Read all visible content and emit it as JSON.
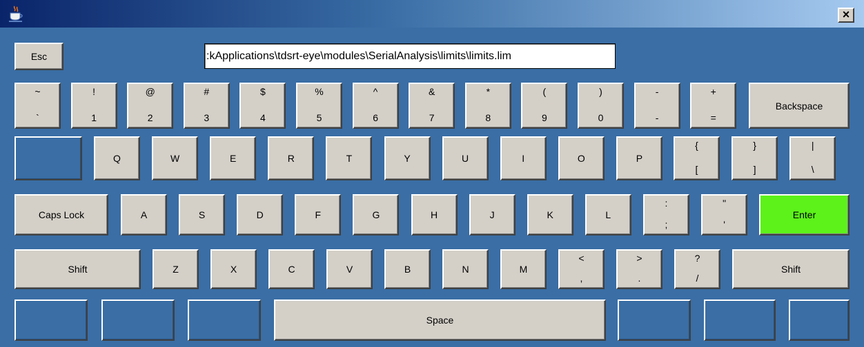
{
  "window": {
    "close_label": "×"
  },
  "path_field": {
    "value": ":kApplications\\tdsrt-eye\\modules\\SerialAnalysis\\limits\\limits.lim"
  },
  "keys": {
    "esc": "Esc",
    "backspace": "Backspace",
    "caps": "Caps Lock",
    "enter": "Enter",
    "shift": "Shift",
    "space": "Space",
    "enter_color": "#5cf21a"
  },
  "number_row": [
    {
      "top": "~",
      "bottom": "`"
    },
    {
      "top": "!",
      "bottom": "1"
    },
    {
      "top": "@",
      "bottom": "2"
    },
    {
      "top": "#",
      "bottom": "3"
    },
    {
      "top": "$",
      "bottom": "4"
    },
    {
      "top": "%",
      "bottom": "5"
    },
    {
      "top": "^",
      "bottom": "6"
    },
    {
      "top": "&",
      "bottom": "7"
    },
    {
      "top": "*",
      "bottom": "8"
    },
    {
      "top": "(",
      "bottom": "9"
    },
    {
      "top": ")",
      "bottom": "0"
    },
    {
      "top": "-",
      "bottom": "-"
    },
    {
      "top": "+",
      "bottom": "="
    }
  ],
  "qwerty_row": [
    "Q",
    "W",
    "E",
    "R",
    "T",
    "Y",
    "U",
    "I",
    "O",
    "P"
  ],
  "qwerty_symbols": [
    {
      "top": "{",
      "bottom": "["
    },
    {
      "top": "}",
      "bottom": "]"
    },
    {
      "top": "|",
      "bottom": "\\"
    }
  ],
  "home_row": [
    "A",
    "S",
    "D",
    "F",
    "G",
    "H",
    "J",
    "K",
    "L"
  ],
  "home_symbols": [
    {
      "top": ":",
      "bottom": ";"
    },
    {
      "top": "\"",
      "bottom": "'"
    }
  ],
  "bottom_row": [
    "Z",
    "X",
    "C",
    "V",
    "B",
    "N",
    "M"
  ],
  "bottom_symbols": [
    {
      "top": "<",
      "bottom": ","
    },
    {
      "top": ">",
      "bottom": "."
    },
    {
      "top": "?",
      "bottom": "/"
    }
  ]
}
